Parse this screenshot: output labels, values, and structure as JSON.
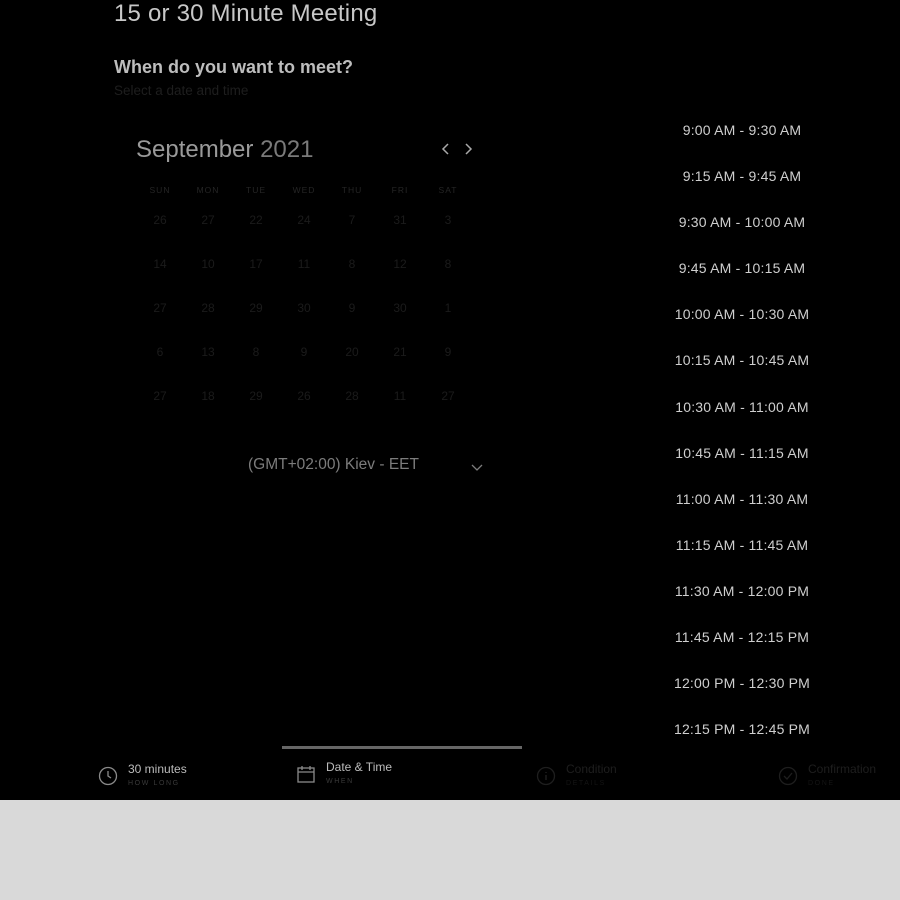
{
  "header": {
    "title": "15 or 30 Minute Meeting",
    "subtitle": "When do you want to meet?",
    "hint": "Select a date and time"
  },
  "calendar": {
    "month": "September",
    "year": "2021",
    "weekdays": [
      "SUN",
      "MON",
      "TUE",
      "WED",
      "THU",
      "FRI",
      "SAT"
    ],
    "weeks": [
      [
        "26",
        "27",
        "22",
        "24",
        "7",
        "31",
        "3"
      ],
      [
        "14",
        "10",
        "17",
        "11",
        "8",
        "12",
        "8"
      ],
      [
        "27",
        "28",
        "29",
        "30",
        "9",
        "30",
        "1"
      ],
      [
        "6",
        "13",
        "8",
        "9",
        "20",
        "21",
        "9"
      ],
      [
        "27",
        "18",
        "29",
        "26",
        "28",
        "11",
        "27"
      ]
    ]
  },
  "timezone": {
    "label": "(GMT+02:00) Kiev - EET",
    "icon": "chevron-down-icon"
  },
  "time_slots": [
    "9:00 AM - 9:30 AM",
    "9:15 AM - 9:45 AM",
    "9:30 AM - 10:00 AM",
    "9:45 AM - 10:15 AM",
    "10:00 AM - 10:30 AM",
    "10:15 AM - 10:45 AM",
    "10:30 AM - 11:00 AM",
    "10:45 AM - 11:15 AM",
    "11:00 AM - 11:30 AM",
    "11:15 AM - 11:45 AM",
    "11:30 AM - 12:00 PM",
    "11:45 AM - 12:15 PM",
    "12:00 PM - 12:30 PM",
    "12:15 PM - 12:45 PM"
  ],
  "steps": [
    {
      "label": "30 minutes",
      "sub": "HOW LONG",
      "icon": "clock-icon"
    },
    {
      "label": "Date & Time",
      "sub": "WHEN",
      "icon": "calendar-icon"
    },
    {
      "label": "Condition",
      "sub": "DETAILS",
      "icon": "info-icon"
    },
    {
      "label": "Confirmation",
      "sub": "DONE",
      "icon": "check-circle-icon"
    }
  ],
  "colors": {
    "background": "#000000",
    "below_frame": "#d9d9d9",
    "active_step_bar": "#666666"
  }
}
